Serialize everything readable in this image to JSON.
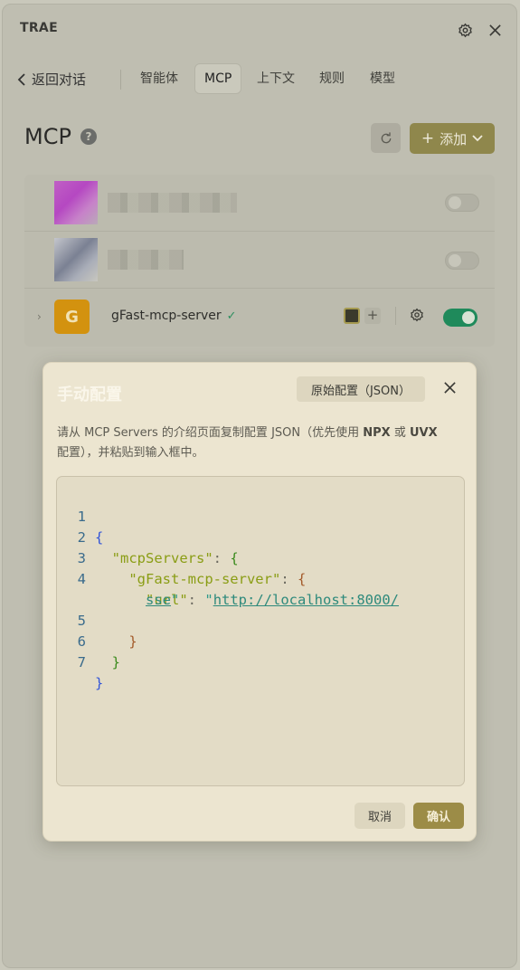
{
  "app": {
    "title": "TRAE"
  },
  "nav": {
    "back_label": "返回对话",
    "tabs": [
      {
        "label": "智能体"
      },
      {
        "label": "MCP"
      },
      {
        "label": "上下文"
      },
      {
        "label": "规则"
      },
      {
        "label": "模型"
      }
    ],
    "active_tab": "MCP"
  },
  "section": {
    "title": "MCP",
    "help_glyph": "?",
    "add_label": "添加"
  },
  "servers": [
    {
      "name": "",
      "enabled": false,
      "blurred": true
    },
    {
      "name": "",
      "enabled": false,
      "blurred": true
    },
    {
      "name": "gFast-mcp-server",
      "avatar_letter": "G",
      "verified": true,
      "enabled": true,
      "avatar_color": "#d3920f"
    }
  ],
  "modal": {
    "title": "手动配置",
    "raw_config_label": "原始配置（JSON）",
    "description_1": "请从 MCP Servers 的介绍页面复制配置 JSON（优先使用 ",
    "description_npx": "NPX",
    "description_2": " 或 ",
    "description_uvx": "UVX",
    "description_3": "配置），并粘贴到输入框中。",
    "editor": {
      "line_numbers": [
        "1",
        "2",
        "3",
        "4",
        "5",
        "6",
        "7"
      ],
      "key_mcp": "\"mcpServers\"",
      "key_server": "\"gFast-mcp-server\"",
      "key_url": "\"url\"",
      "url_part1": "http://localhost:8000/",
      "url_part2": "sse"
    },
    "cancel_label": "取消",
    "confirm_label": "确认"
  },
  "colors": {
    "accent": "#8f874c",
    "toggle_on": "#1f8a5b",
    "verified": "#2d8f5f"
  }
}
